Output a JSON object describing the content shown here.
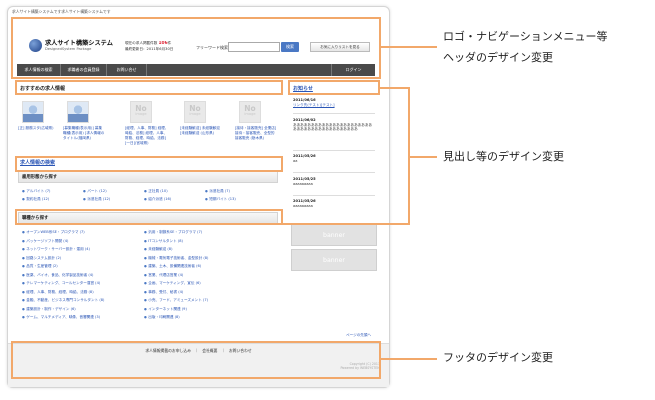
{
  "site": {
    "top_line": "求人サイト構築システムです求人サイト構築システムです",
    "title": "求人サイト構築システム",
    "subtitle": "DesignedSystem Package",
    "count_line1_pre": "現在の求人掲載件数",
    "count_value": "106",
    "count_unit": "件",
    "count_line2": "最終更新日：2011年6月30日",
    "keyword_label": "フリーワード検索",
    "search_button": "検索",
    "list_button": "お気に入りリストを見る"
  },
  "nav": [
    "求人情報の検索",
    "求職者の会員登録",
    "お問い合せ",
    "ログイン"
  ],
  "recommend": {
    "title": "おすすめの求人情報",
    "items": [
      {
        "thumb": "photo",
        "caption": "[正] 服務スタ(広域県)"
      },
      {
        "thumb": "photo",
        "caption": "[募集職種(表示用)] 募集職種(表示用) [求人情報のタイトル(福岡県)"
      },
      {
        "thumb": "noimage",
        "caption": "[経理、人事、財務] 経理、時給、法務] 経理、人事、財務、経理、時給、法務][一日](宮城県)"
      },
      {
        "thumb": "noimage",
        "caption": "[未経験歓迎] 未経験歓迎 [未経験歓迎 (山形県)"
      },
      {
        "thumb": "noimage",
        "caption": "[接待・接客販売] 全業店] 接待・接客販売、全型的接客販売 (栃木県)"
      }
    ],
    "noimage_main": "No",
    "noimage_sub": "image"
  },
  "search": {
    "title": "求人情報の検索",
    "employment_title": "雇用形態から探す",
    "employment": [
      "アルバイト (7)",
      "パート (12)",
      "正社員 (10)",
      "派遣社員 (7)",
      "契約社員 (12)",
      "派遣社員 (12)",
      "紹介派遣 (16)",
      "短期バイト (13)"
    ],
    "occupation_title": "職種から探す",
    "occupations_left": [
      "オープンWEB系SE・プログラマ (7)",
      "パッケージソフト開発 (4)",
      "ネットワーク・サーバー設計・運用 (4)",
      "回路システム設計 (2)",
      "品質・生産管理 (2)",
      "医薬、バイオ、食品、化学製品技術者 (4)",
      "テレマーケティング、コールセンター運営 (4)",
      "経理、人事、財務、経理、時給、法務 (8)",
      "金融、不動産、ビジネス専門コンサルタント (8)",
      "建築設計・制作・デザイン (6)",
      "ゲーム、マルチメディア、映像、音響関連 (3)"
    ],
    "occupations_right": [
      "汎用・制御系SE・プログラマ (7)",
      "ITコンサルタント (8)",
      "未経験歓迎 (8)",
      "機械・電気電子技術者、金型設計 (8)",
      "建築、土木、設備関連技術者 (6)",
      "営業、代理店営業 (4)",
      "企画、マーケティング、宣伝 (6)",
      "事務、受付、秘書 (4)",
      "小売、フード、アミューズメント (7)",
      "インターネット関連 (9)",
      "出版・印刷関連 (8)"
    ],
    "more_link": "ページの先頭へ"
  },
  "news": {
    "title": "お知らせ",
    "items": [
      {
        "date": "2011/06/16",
        "text": "リンク先(テスト)[テスト]"
      },
      {
        "date": "2011/06/02",
        "text": "ああああああああああああああああああああああああああああああああああああああああ"
      },
      {
        "date": "2011/05/26",
        "text": "aa"
      },
      {
        "date": "2011/05/25",
        "text": "aaaaaaaaa"
      },
      {
        "date": "2011/05/26",
        "text": "aaaaaaaaa"
      }
    ],
    "banners": [
      "banner",
      "banner"
    ]
  },
  "footer": {
    "links": "求人情報掲載のお申し込み　｜　会社概要　｜　お問い合わせ",
    "copy1": "Copyright (C) 2011",
    "copy2": "Powered by WEBSYSTEM"
  },
  "callouts": {
    "header": [
      "ロゴ・ナビゲーションメニュー等",
      "ヘッダのデザイン変更"
    ],
    "headings": "見出し等のデザイン変更",
    "footer": "フッタのデザイン変更"
  },
  "colors": {
    "highlight": "#f2a86a",
    "nav_bg": "#4a4a4a",
    "link": "#2a55b5"
  }
}
